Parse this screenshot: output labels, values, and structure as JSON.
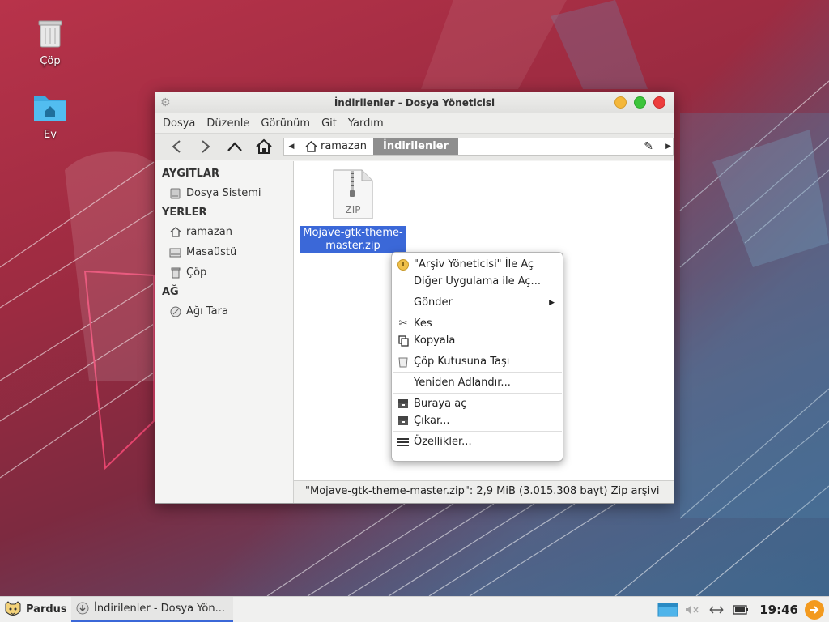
{
  "desktop": {
    "icons": [
      {
        "label": "Çöp"
      },
      {
        "label": "Ev"
      }
    ]
  },
  "window": {
    "title": "İndirilenler - Dosya Yöneticisi",
    "menu": [
      "Dosya",
      "Düzenle",
      "Görünüm",
      "Git",
      "Yardım"
    ],
    "path": {
      "home": "ramazan",
      "current": "İndirilenler"
    },
    "sidebar": {
      "devices_header": "AYGITLAR",
      "devices": [
        {
          "label": "Dosya Sistemi"
        }
      ],
      "places_header": "YERLER",
      "places": [
        {
          "label": "ramazan"
        },
        {
          "label": "Masaüstü"
        },
        {
          "label": "Çöp"
        }
      ],
      "network_header": "AĞ",
      "network": [
        {
          "label": "Ağı Tara"
        }
      ]
    },
    "file": {
      "type_badge": "ZIP",
      "name": "Mojave-gtk-theme-master.zip"
    },
    "status": "\"Mojave-gtk-theme-master.zip\": 2,9 MiB (3.015.308 bayt) Zip arşivi"
  },
  "context_menu": {
    "items": [
      "\"Arşiv Yöneticisi\" İle Aç",
      "Diğer Uygulama ile Aç...",
      "Gönder",
      "Kes",
      "Kopyala",
      "Çöp Kutusuna Taşı",
      "Yeniden Adlandır...",
      "Buraya aç",
      "Çıkar...",
      "Özellikler..."
    ]
  },
  "taskbar": {
    "start_label": "Pardus",
    "task_label": "İndirilenler - Dosya Yön...",
    "clock": "19:46"
  }
}
